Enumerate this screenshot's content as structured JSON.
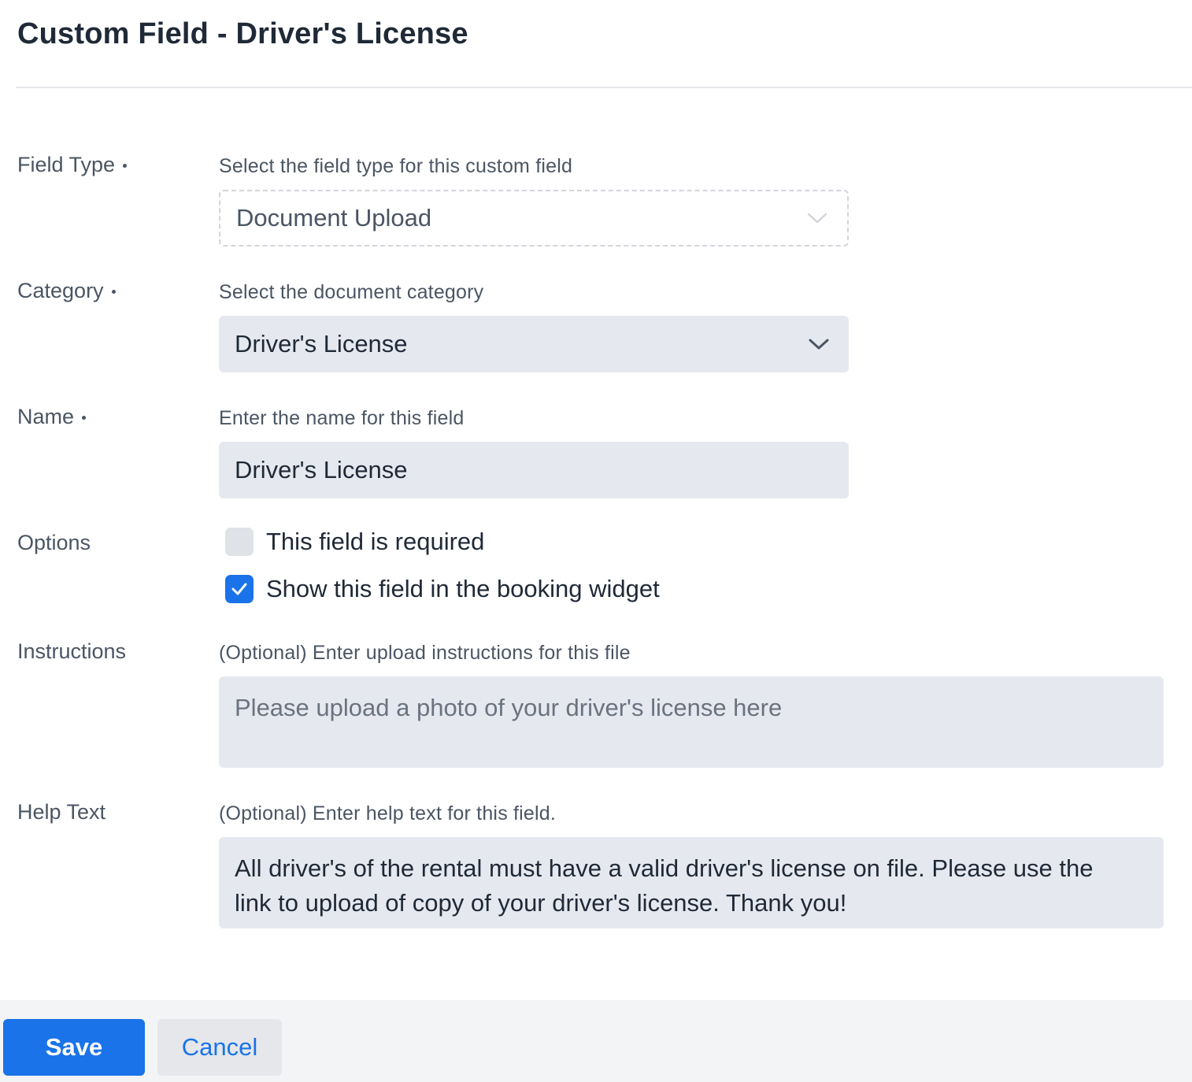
{
  "page": {
    "title": "Custom Field - Driver's License"
  },
  "form": {
    "field_type": {
      "label": "Field Type",
      "hint": "Select the field type for this custom field",
      "value": "Document Upload"
    },
    "category": {
      "label": "Category",
      "hint": "Select the document category",
      "value": "Driver's License"
    },
    "name": {
      "label": "Name",
      "hint": "Enter the name for this field",
      "value": "Driver's License"
    },
    "options": {
      "label": "Options",
      "required_label": "This field is required",
      "required_checked": false,
      "widget_label": "Show this field in the booking widget",
      "widget_checked": true
    },
    "instructions": {
      "label": "Instructions",
      "hint": "(Optional) Enter upload instructions for this file",
      "placeholder": "Please upload a photo of your driver's license here"
    },
    "help_text": {
      "label": "Help Text",
      "hint": "(Optional) Enter help text for this field.",
      "value": "All driver's of the rental must have a valid driver's license on file. Please use the link to upload of copy of your driver's license. Thank you!"
    }
  },
  "footer": {
    "save_label": "Save",
    "cancel_label": "Cancel"
  },
  "colors": {
    "accent": "#1a73e8",
    "field_bg": "#e5e9ef",
    "footer_bg": "#f3f4f6"
  },
  "icons": {
    "select_chevron": "chevron-down-icon",
    "checkbox_check": "check-icon"
  }
}
